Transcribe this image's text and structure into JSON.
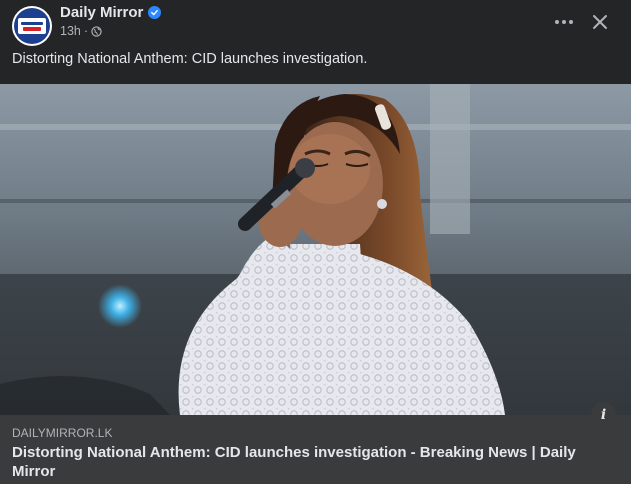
{
  "post": {
    "page_name": "Daily Mirror",
    "time": "13h",
    "dot": "·",
    "caption": "Distorting National Anthem: CID launches investigation."
  },
  "icons": {
    "verified": "verified-badge-icon",
    "globe": "globe-icon",
    "more": "more-options-icon",
    "close": "close-icon",
    "info": "info-icon"
  },
  "link_preview": {
    "domain": "DAILYMIRROR.LK",
    "title": "Distorting National Anthem: CID launches investigation - Breaking News | Daily Mirror",
    "info_glyph": "i"
  },
  "colors": {
    "background": "#242526",
    "preview_bg": "#3a3b3c",
    "primary_text": "#e4e6eb",
    "secondary_text": "#b0b3b8",
    "verified_blue": "#2d88ff"
  }
}
